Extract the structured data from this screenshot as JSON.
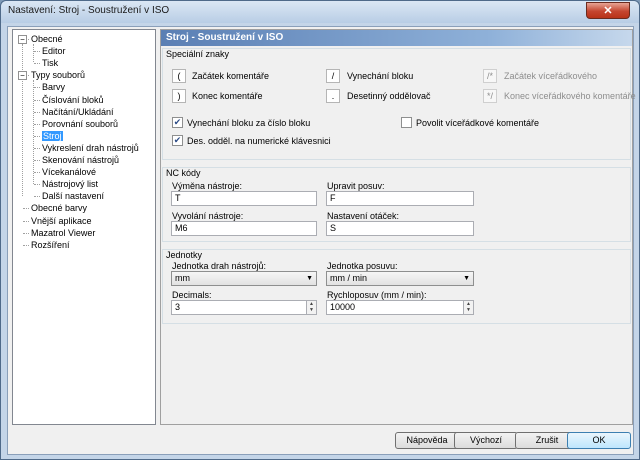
{
  "window": {
    "title": "Nastavení: Stroj - Soustružení v ISO",
    "close_label": "✕"
  },
  "tree": {
    "items": [
      {
        "label": "Obecné",
        "level": 0,
        "expander": "−"
      },
      {
        "label": "Editor",
        "level": 1
      },
      {
        "label": "Tisk",
        "level": 1
      },
      {
        "label": "Typy souborů",
        "level": 0,
        "expander": "−"
      },
      {
        "label": "Barvy",
        "level": 1
      },
      {
        "label": "Číslování bloků",
        "level": 1
      },
      {
        "label": "Načítání/Ukládání",
        "level": 1
      },
      {
        "label": "Porovnání souborů",
        "level": 1
      },
      {
        "label": "Stroj",
        "level": 1,
        "selected": true
      },
      {
        "label": "Vykreslení drah nástrojů",
        "level": 1
      },
      {
        "label": "Skenování nástrojů",
        "level": 1
      },
      {
        "label": "Vícekanálové",
        "level": 1
      },
      {
        "label": "Nástrojový list",
        "level": 1
      },
      {
        "label": "Další nastavení",
        "level": 1
      },
      {
        "label": "Obecné barvy",
        "level": 0
      },
      {
        "label": "Vnější aplikace",
        "level": 0
      },
      {
        "label": "Mazatrol Viewer",
        "level": 0
      },
      {
        "label": "Rozšíření",
        "level": 0
      }
    ]
  },
  "panel": {
    "header": "Stroj - Soustružení v ISO",
    "special_chars": {
      "title": "Speciální znaky",
      "comment_start": {
        "char": "(",
        "label": "Začátek komentáře"
      },
      "comment_end": {
        "char": ")",
        "label": "Konec komentáře"
      },
      "block_skip": {
        "char": "/",
        "label": "Vynechání bloku"
      },
      "decimal_sep": {
        "char": ".",
        "label": "Desetinný oddělovač"
      },
      "multiline_start": {
        "char": "/*",
        "label": "Začátek víceřádkového"
      },
      "multiline_end": {
        "char": "*/",
        "label": "Konec víceřádkového komentáře"
      },
      "cb_skip_after_block": {
        "label": "Vynechání bloku za číslo bloku",
        "checked": true
      },
      "cb_decimal_numpad": {
        "label": "Des. odděl. na numerické klávesnici",
        "checked": true
      },
      "cb_multiline": {
        "label": "Povolit víceřádkové komentáře",
        "checked": false
      }
    },
    "nc_codes": {
      "title": "NC kódy",
      "tool_change": {
        "label": "Výměna nástroje:",
        "value": "T"
      },
      "feed_adjust": {
        "label": "Upravit posuv:",
        "value": "F"
      },
      "tool_call": {
        "label": "Vyvolání nástroje:",
        "value": "M6"
      },
      "spindle_speed": {
        "label": "Nastavení otáček:",
        "value": "S"
      }
    },
    "units": {
      "title": "Jednotky",
      "toolpath_unit": {
        "label": "Jednotka drah nástrojů:",
        "value": "mm"
      },
      "feed_unit": {
        "label": "Jednotka posuvu:",
        "value": "mm / min"
      },
      "decimals": {
        "label": "Decimals:",
        "value": "3"
      },
      "rapid_feed": {
        "label": "Rychloposuv (mm / min):",
        "value": "10000"
      }
    }
  },
  "footer": {
    "help": "Nápověda",
    "default": "Výchozí",
    "cancel": "Zrušit",
    "ok": "OK"
  }
}
